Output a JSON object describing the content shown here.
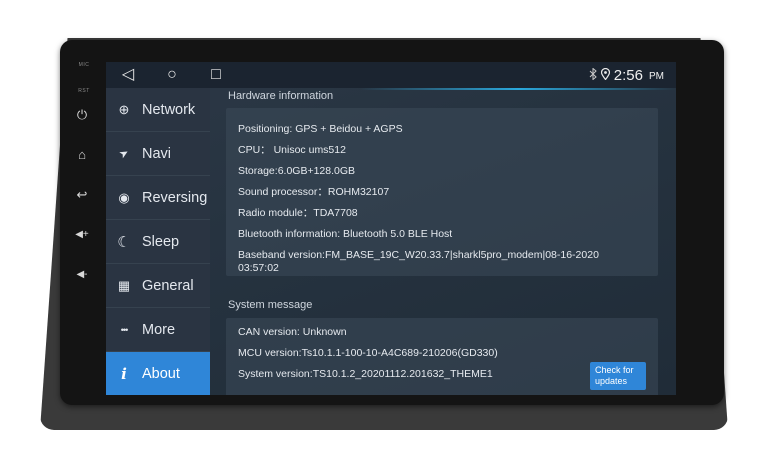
{
  "statusbar": {
    "time": "2:56",
    "ampm": "PM",
    "nav": {
      "back": "◁",
      "home": "○",
      "recent": "□"
    },
    "icons": [
      "bluetooth-icon",
      "location-icon"
    ]
  },
  "device": {
    "side_buttons": [
      "⏻",
      "⌂",
      "↩",
      "◀+",
      "◀-"
    ],
    "labels": [
      "MIC",
      "RST"
    ]
  },
  "sidebar": {
    "items": [
      {
        "label": "Network",
        "icon": "globe-icon",
        "glyph": "⊕"
      },
      {
        "label": "Navi",
        "icon": "navigation-arrow-icon",
        "glyph": "➤"
      },
      {
        "label": "Reversing",
        "icon": "reverse-icon",
        "glyph": "◉"
      },
      {
        "label": "Sleep",
        "icon": "moon-icon",
        "glyph": "☾"
      },
      {
        "label": "General",
        "icon": "building-icon",
        "glyph": "▦"
      },
      {
        "label": "More",
        "icon": "more-dots-icon",
        "glyph": "•••"
      },
      {
        "label": "About",
        "icon": "info-icon",
        "glyph": "i"
      }
    ],
    "active": "About"
  },
  "hardware": {
    "title": "Hardware information",
    "rows": [
      "Positioning: GPS + Beidou + AGPS",
      "CPU： Unisoc ums512",
      "Storage:6.0GB+128.0GB",
      "Sound processor：ROHM32107",
      "Radio module：TDA7708",
      "Bluetooth information: Bluetooth 5.0 BLE Host",
      "Baseband version:FM_BASE_19C_W20.33.7|sharkl5pro_modem|08-16-2020 03:57:02"
    ]
  },
  "system": {
    "title": "System message",
    "rows": [
      "CAN version: Unknown",
      "MCU version:Ts10.1.1-100-10-A4C689-210206(GD330)",
      "System version:TS10.1.2_20201112.201632_THEME1"
    ],
    "check_button": "Check for updates"
  },
  "colors": {
    "accent": "#2f86d8",
    "sidebar_bg": "#2a3442",
    "screen_bg": "#263340"
  }
}
